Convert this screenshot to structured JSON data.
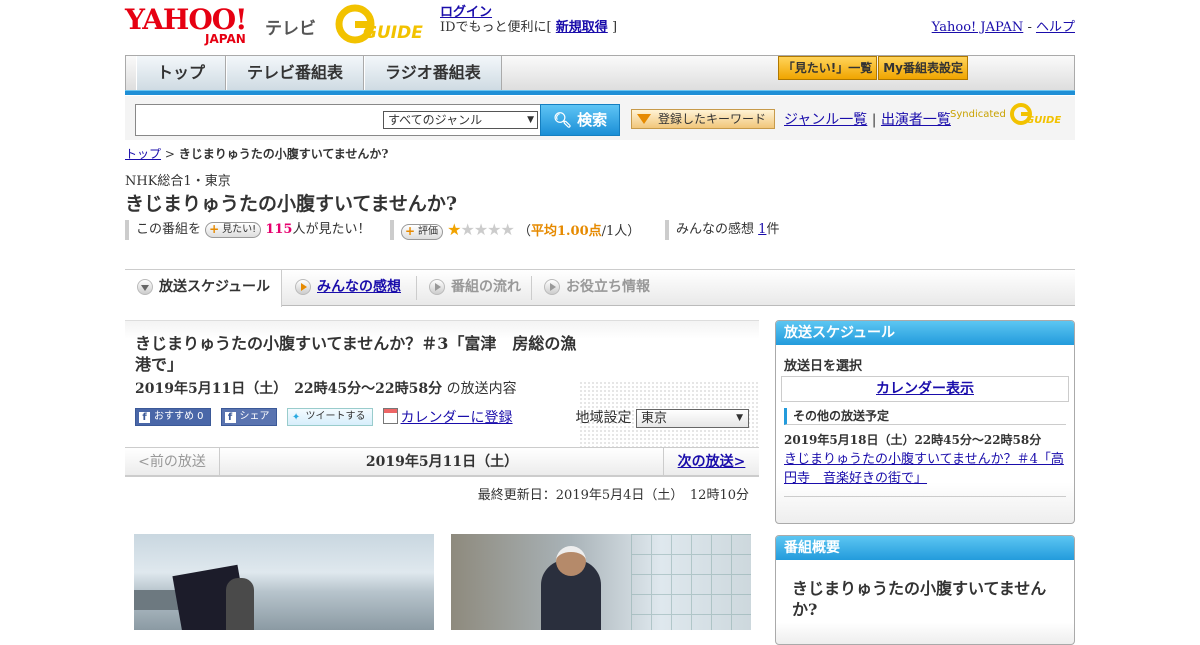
{
  "header": {
    "logo_text": "YAHOO!",
    "logo_sub": "JAPAN",
    "service_name": "テレビ",
    "gguide_logo": "GUIDE",
    "login_link": "ログイン",
    "login_text_pre": "IDでもっと便利に[",
    "signup_link": "新規取得",
    "login_text_post": "]",
    "yahoo_japan_link": "Yahoo! JAPAN",
    "separator": "-",
    "help_link": "ヘルプ"
  },
  "nav": {
    "tabs": [
      "トップ",
      "テレビ番組表",
      "ラジオ番組表"
    ],
    "want_list_btn": "「見たい!」一覧",
    "my_schedule_btn": "My番組表設定"
  },
  "search": {
    "genre_value": "すべてのジャンル",
    "search_btn": "検索",
    "keyword_btn": "登録したキーワード",
    "genre_list_link": "ジャンル一覧",
    "divider": "|",
    "performer_list_link": "出演者一覧",
    "syndicated": "Syndicated"
  },
  "breadcrumb": {
    "top_link": "トップ",
    "sep": ">",
    "current": "きじまりゅうたの小腹すいてませんか?"
  },
  "program": {
    "channel": "NHK総合1・東京",
    "title": "きじまりゅうたの小腹すいてませんか?",
    "want_prefix": "この番組を",
    "want_btn": "見たい!",
    "want_count": "115",
    "want_suffix": "人が見たい！",
    "rating_btn": "評価",
    "rating_value": 1,
    "rating_max": 5,
    "rating_open": "（",
    "rating_avg": "平均1.00点",
    "rating_people": "/1人）",
    "review_label": "みんなの感想",
    "review_count": "1",
    "review_suffix": "件"
  },
  "tabs": {
    "schedule": "放送スケジュール",
    "reviews": "みんなの感想",
    "flow": "番組の流れ",
    "info": "お役立ち情報"
  },
  "episode": {
    "title": "きじまりゅうたの小腹すいてませんか？＃3「富津　房総の漁港で」",
    "date_time": "2019年5月11日（土）　22時45分～22時58分",
    "content_suffix": "の放送内容",
    "fb_recommend": "おすすめ 0",
    "fb_share": "シェア",
    "tweet": "ツイートする",
    "calendar_register": "カレンダーに登録",
    "region_label": "地域設定",
    "region_value": "東京"
  },
  "pager": {
    "prev": "<前の放送",
    "current_date": "2019年5月11日（土）",
    "next": "次の放送>"
  },
  "updated": "最終更新日：2019年5月4日（土）　12時10分",
  "sidebar": {
    "schedule_head": "放送スケジュール",
    "select_date": "放送日を選択",
    "calendar_btn": "カレンダー表示",
    "other_head": "その他の放送予定",
    "other_date": "2019年5月18日（土）22時45分～22時58分",
    "other_link": "きじまりゅうたの小腹すいてませんか？＃4「高円寺　音楽好きの街で」",
    "overview_head": "番組概要",
    "overview_title": "きじまりゅうたの小腹すいてませんか?"
  },
  "colors": {
    "accent_blue": "#239bdc",
    "star_on": "#f1a300",
    "link": "#1a0dab"
  }
}
